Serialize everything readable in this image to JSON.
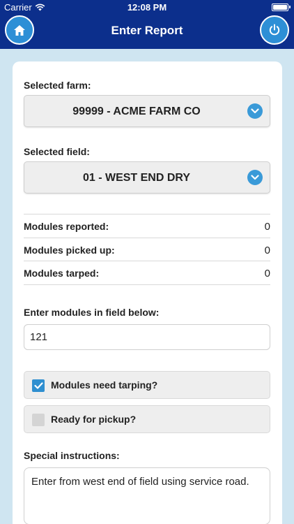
{
  "status_bar": {
    "carrier": "Carrier",
    "time": "12:08 PM",
    "battery_level": 1.0
  },
  "header": {
    "title": "Enter Report",
    "home_icon": "home-icon",
    "power_icon": "power-icon",
    "color": "#0c2f8c",
    "button_color": "#2d8fd6"
  },
  "farm": {
    "label": "Selected farm:",
    "value": "99999 - ACME FARM CO"
  },
  "field": {
    "label": "Selected field:",
    "value": "01 - WEST END DRY"
  },
  "stats": [
    {
      "label": "Modules reported:",
      "value": "0"
    },
    {
      "label": "Modules picked up:",
      "value": "0"
    },
    {
      "label": "Modules tarped:",
      "value": "0"
    }
  ],
  "modules_input": {
    "label": "Enter modules in field below:",
    "value": "121"
  },
  "checks": [
    {
      "label": "Modules need tarping?",
      "checked": true
    },
    {
      "label": "Ready for pickup?",
      "checked": false
    }
  ],
  "instructions": {
    "label": "Special instructions:",
    "value": "Enter from west end of field using service road."
  }
}
